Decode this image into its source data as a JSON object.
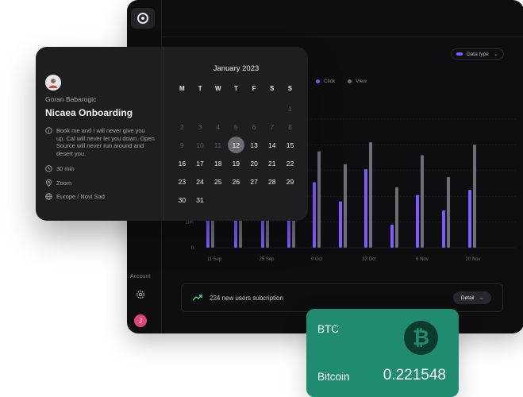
{
  "dashboard": {
    "data_type_label": "Data type",
    "legend": [
      {
        "label": "Click",
        "color": "#7b5cff"
      },
      {
        "label": "View",
        "color": "#6e6e78"
      }
    ],
    "account_label": "Account",
    "user_initial": "J",
    "notice_text": "224 new users subcription",
    "detail_label": "Detail"
  },
  "chart_data": {
    "type": "bar",
    "x_tick_labels": [
      "11 Sep",
      "25 Sep",
      "9 Oct",
      "23 Oct",
      "6 Nov",
      "20 Nov"
    ],
    "y_tick_labels": [
      "0",
      "20K"
    ],
    "series": [
      {
        "name": "Click",
        "color": "#7b5cff",
        "values": [
          28,
          22,
          42,
          30,
          51,
          36,
          61,
          18,
          41,
          29,
          45
        ]
      },
      {
        "name": "View",
        "color": "#6e6e78",
        "values": [
          77,
          72,
          80,
          76,
          75,
          65,
          82,
          47,
          72,
          55,
          80
        ]
      }
    ],
    "ylim": [
      0,
      100
    ]
  },
  "calendar": {
    "host_name": "Goran Babarogic",
    "event_title": "Nicaea Onboarding",
    "description": "Book me and I will never give you up. Cal will never let you down. Open Source will never run around and desert you.",
    "duration": "30 min",
    "app": "Zoom",
    "timezone": "Europe / Novi Sad",
    "month_label": "January 2023",
    "weekdays": [
      "M",
      "T",
      "W",
      "T",
      "F",
      "S",
      "S"
    ],
    "days": [
      {
        "d": "",
        "dim": true
      },
      {
        "d": "",
        "dim": true
      },
      {
        "d": "",
        "dim": true
      },
      {
        "d": "",
        "dim": true
      },
      {
        "d": "",
        "dim": true
      },
      {
        "d": "",
        "dim": true
      },
      {
        "d": "1",
        "dim": true
      },
      {
        "d": "2",
        "dim": true
      },
      {
        "d": "3",
        "dim": true
      },
      {
        "d": "4",
        "dim": true
      },
      {
        "d": "5",
        "dim": true
      },
      {
        "d": "6",
        "dim": true
      },
      {
        "d": "7",
        "dim": true
      },
      {
        "d": "8",
        "dim": true
      },
      {
        "d": "9",
        "dim": true
      },
      {
        "d": "10",
        "dim": true
      },
      {
        "d": "11",
        "dim": true
      },
      {
        "d": "12",
        "selected": true
      },
      {
        "d": "13"
      },
      {
        "d": "14"
      },
      {
        "d": "15"
      },
      {
        "d": "16"
      },
      {
        "d": "17"
      },
      {
        "d": "18"
      },
      {
        "d": "19"
      },
      {
        "d": "20"
      },
      {
        "d": "21"
      },
      {
        "d": "22"
      },
      {
        "d": "23"
      },
      {
        "d": "24"
      },
      {
        "d": "25"
      },
      {
        "d": "26"
      },
      {
        "d": "27"
      },
      {
        "d": "28"
      },
      {
        "d": "29"
      },
      {
        "d": "30"
      },
      {
        "d": "31"
      }
    ]
  },
  "btc": {
    "symbol": "BTC",
    "name": "Bitcoin",
    "value": "0.221548",
    "icon": "bitcoin-icon"
  }
}
